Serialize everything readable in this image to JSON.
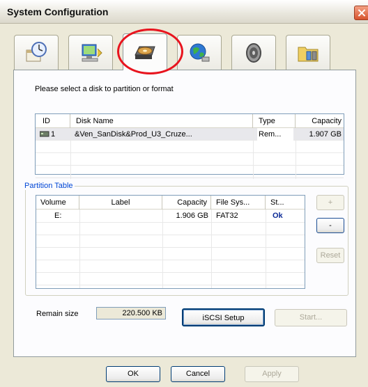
{
  "window": {
    "title": "System Configuration"
  },
  "tabs": [
    {
      "icon": "clock-calendar-icon"
    },
    {
      "icon": "network-computer-icon"
    },
    {
      "icon": "hard-disk-icon",
      "active": true
    },
    {
      "icon": "globe-network-icon"
    },
    {
      "icon": "speaker-icon"
    },
    {
      "icon": "folder-tools-icon"
    }
  ],
  "main": {
    "prompt": "Please select a disk to partition or format"
  },
  "disk_table": {
    "columns": [
      "ID",
      "Disk Name",
      "Type",
      "Capacity"
    ],
    "rows": [
      {
        "id": "1",
        "name": "&Ven_SanDisk&Prod_U3_Cruze...",
        "type": "Rem...",
        "capacity": "1.907 GB"
      }
    ]
  },
  "partition_table": {
    "group_label": "Partition Table",
    "columns": [
      "Volume",
      "Label",
      "Capacity",
      "File Sys...",
      "St..."
    ],
    "rows": [
      {
        "volume": "E:",
        "label": "",
        "capacity": "1.906 GB",
        "filesystem": "FAT32",
        "status": "Ok"
      }
    ],
    "add_label": "+",
    "remove_label": "-",
    "reset_label": "Reset"
  },
  "remain": {
    "label": "Remain size",
    "value": "220.500 KB"
  },
  "buttons": {
    "iscsi": "iSCSI Setup",
    "start": "Start...",
    "ok": "OK",
    "cancel": "Cancel",
    "apply": "Apply"
  }
}
